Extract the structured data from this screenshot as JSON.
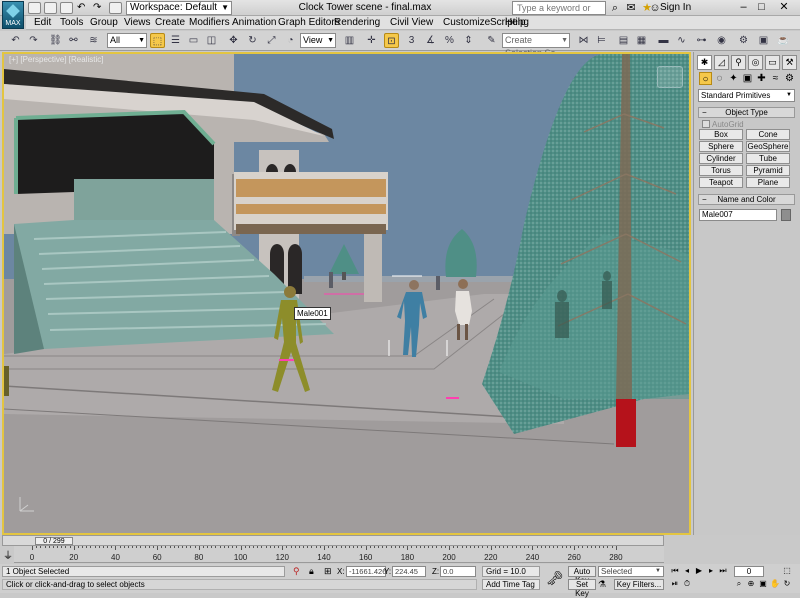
{
  "app": {
    "badge": "MAX",
    "document_title": "Clock Tower scene - final.max"
  },
  "titlebar": {
    "quick_access_icons": [
      "new-icon",
      "open-icon",
      "save-icon",
      "undo-icon",
      "redo-icon",
      "project-folder-icon"
    ],
    "workspace_label": "Workspace: Default",
    "search_placeholder": "Type a keyword or phrase",
    "sign_in": "Sign In",
    "window_buttons": [
      "minimize-icon",
      "maximize-icon",
      "close-icon"
    ]
  },
  "menu": [
    "Edit",
    "Tools",
    "Group",
    "Views",
    "Create",
    "Modifiers",
    "Animation",
    "Graph Editors",
    "Rendering",
    "Civil View",
    "Customize",
    "Scripting",
    "Help"
  ],
  "toolbar": {
    "selection_filter": "All",
    "reference_coord": "View",
    "named_selection_placeholder": "Create Selection Se"
  },
  "viewport": {
    "label": "[+] [Perspective] [Realistic]",
    "object_label": "Male001",
    "colors": {
      "border": "#e3c541",
      "sky": "#6c87a2",
      "ground": "#a09c9c"
    }
  },
  "command_panel": {
    "tabs": [
      "create-tab",
      "modify-tab",
      "hierarchy-tab",
      "motion-tab",
      "display-tab",
      "utilities-tab"
    ],
    "category_icons": [
      "geometry-icon",
      "shapes-icon",
      "lights-icon",
      "cameras-icon",
      "helpers-icon",
      "spacewarps-icon",
      "systems-icon"
    ],
    "primitive_type": "Standard Primitives",
    "object_type_title": "Object Type",
    "autogrid_label": "AutoGrid",
    "object_buttons": [
      "Box",
      "Cone",
      "Sphere",
      "GeoSphere",
      "Cylinder",
      "Tube",
      "Torus",
      "Pyramid",
      "Teapot",
      "Plane"
    ],
    "name_color_title": "Name and Color",
    "object_name": "Male007",
    "swatch_color": "#8e8e8e"
  },
  "timeline": {
    "frame_counter": "0 / 299",
    "ticks": [
      "0",
      "20",
      "40",
      "60",
      "80",
      "100",
      "120",
      "140",
      "160",
      "180",
      "200",
      "220",
      "240",
      "260",
      "280"
    ]
  },
  "status": {
    "selection": "1 Object Selected",
    "prompt": "Click or click-and-drag to select objects",
    "x_label": "X:",
    "x_value": "-11661.426",
    "y_label": "Y:",
    "y_value": "224.45",
    "z_label": "Z:",
    "z_value": "0.0",
    "grid": "Grid = 10.0",
    "add_time_tag": "Add Time Tag",
    "auto_key": "Auto Key",
    "set_key": "Set Key",
    "key_mode": "Selected",
    "key_filters": "Key Filters...",
    "frame": "0"
  }
}
